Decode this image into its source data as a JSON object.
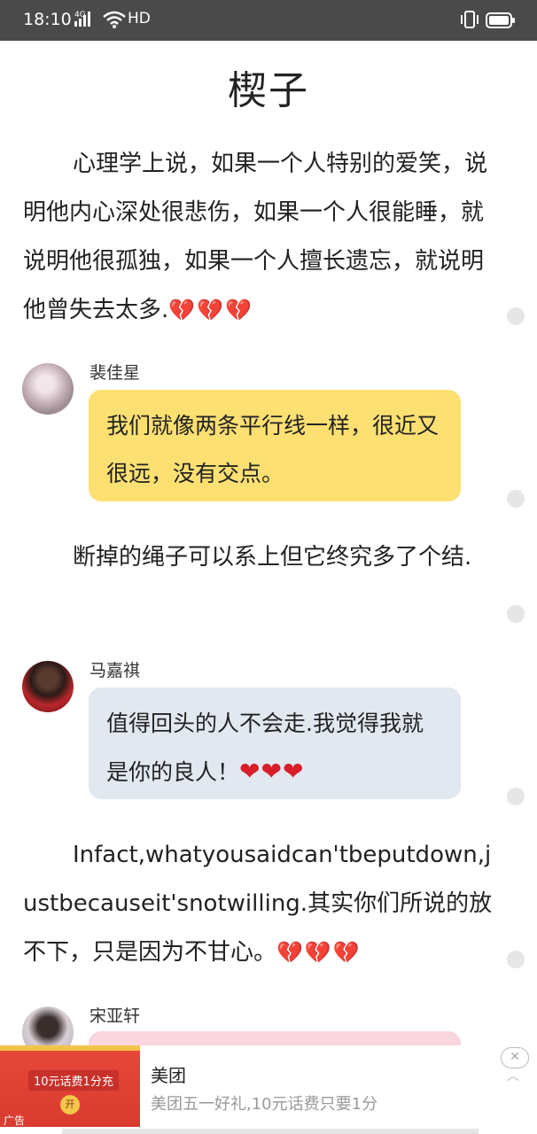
{
  "status_bar": {
    "time": "18:10",
    "network": "4G",
    "hd": "HD",
    "icons": [
      "signal-icon",
      "wifi-icon",
      "vibrate-icon",
      "battery-icon"
    ]
  },
  "page": {
    "title": "楔子"
  },
  "paragraphs": [
    {
      "text": "心理学上说，如果一个人特别的爱笑，说明他内心深处很悲伤，如果一个人很能睡，就说明他很孤独，如果一个人擅长遗忘，就说明他曾失去太多.",
      "emoji": "💔💔💔"
    },
    {
      "text": "断掉的绳子可以系上但它终究多了个结.",
      "emoji": ""
    },
    {
      "text": "Infact,whatyousaidcan'tbeputdown,justbecauseit'snotwilling.其实你们所说的放不下，只是因为不甘心。",
      "emoji": "💔💔💔"
    }
  ],
  "messages": [
    {
      "author": "裴佳星",
      "text": "我们就像两条平行线一样，很近又很远，没有交点。",
      "color": "#fde072"
    },
    {
      "author": "马嘉祺",
      "text": "值得回头的人不会走.我觉得我就是你的良人！",
      "emoji": "❤❤❤",
      "color": "#e2e8f0"
    },
    {
      "author": "宋亚轩",
      "text": "",
      "color": "#f9d5de"
    }
  ],
  "ad": {
    "promo": "10元话费1分充",
    "open_label": "开",
    "ad_label": "广告",
    "title": "美团",
    "description": "美团五一好礼,10元话费只要1分",
    "close_icon": "close-icon"
  }
}
